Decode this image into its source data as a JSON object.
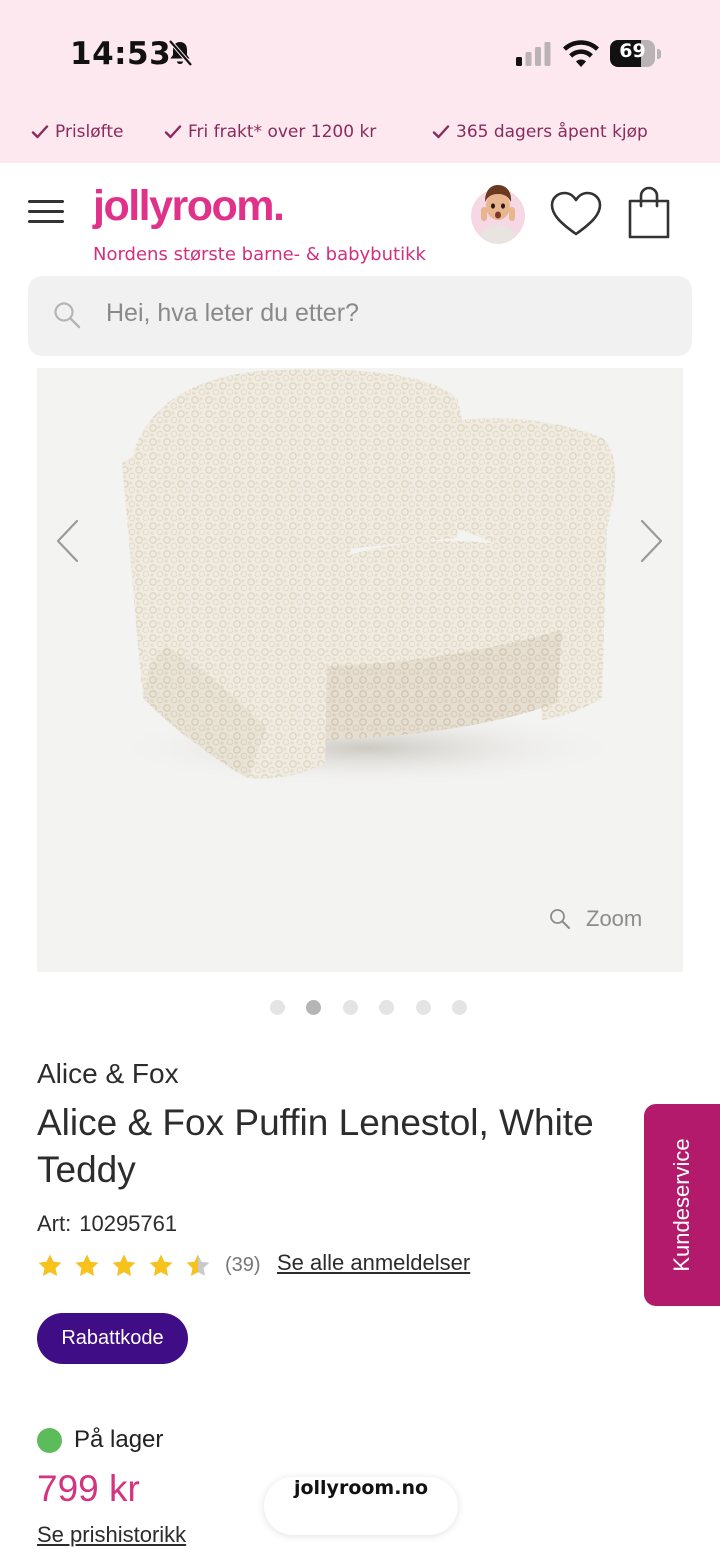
{
  "status_bar": {
    "time": "14:53",
    "battery": "69",
    "battery_level": 0.69
  },
  "usps": [
    "Prisløfte",
    "Fri frakt* over 1200 kr",
    "365 dagers åpent kjøp"
  ],
  "header": {
    "logo": "jollyroom.",
    "tagline": "Nordens største barne- & babybutikk"
  },
  "search": {
    "placeholder": "Hei, hva leter du etter?"
  },
  "gallery": {
    "zoom_label": "Zoom",
    "image_count": 6,
    "active_index": 1
  },
  "product": {
    "brand": "Alice & Fox",
    "title": "Alice & Fox Puffin Lenestol, White Teddy",
    "art_label": "Art:",
    "art_number": "10295761",
    "rating": 4.5,
    "review_count": "(39)",
    "reviews_link": "Se alle anmeldelser",
    "discount_button": "Rabattkode",
    "stock_status": "På lager",
    "price": "799 kr",
    "price_history_link": "Se prishistorikk"
  },
  "browser": {
    "url": "jollyroom.no"
  },
  "customer_service": {
    "label": "Kundeservice"
  },
  "colors": {
    "brand_pink": "#e0328a",
    "band_pink": "#fce8ee",
    "discount_purple": "#3f0d86",
    "service_magenta": "#b41a6b",
    "in_stock_green": "#5cbc5c"
  }
}
